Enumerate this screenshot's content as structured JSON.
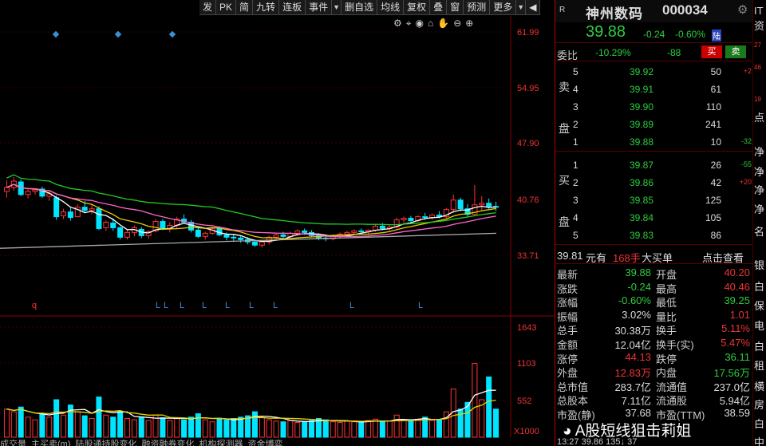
{
  "toolbar": {
    "items": [
      "发",
      "PK",
      "简",
      "九转",
      "连板",
      "事件",
      "删自选",
      "均线",
      "复权",
      "叠",
      "窗",
      "预测",
      "更多"
    ]
  },
  "chart": {
    "y_labels": [
      "61.99",
      "54.95",
      "47.90",
      "40.76",
      "33.71"
    ],
    "vol_labels": [
      "1643",
      "1103",
      "552",
      "X1000"
    ],
    "markers": [
      "q",
      "L",
      "L",
      "L",
      "L",
      "L",
      "L",
      "L",
      "L",
      "L"
    ],
    "colors": {
      "up": "#ff3333",
      "down": "#00e5ff",
      "ma_white": "#ffffff",
      "ma_yellow": "#e8d000",
      "ma_pink": "#ff66cc",
      "ma_green": "#22cc22",
      "ma_gray": "#aaaaaa"
    }
  },
  "chart_data": {
    "type": "candlestick",
    "y_ticks": [
      61.99,
      54.95,
      47.9,
      40.76,
      33.71
    ],
    "volume_ticks": [
      1643,
      1103,
      552
    ],
    "volume_unit": "X1000",
    "candles": [
      [
        41.8,
        43.2,
        41.0,
        42.3
      ],
      [
        42.3,
        43.6,
        41.9,
        43.1
      ],
      [
        43.0,
        43.3,
        41.2,
        41.4
      ],
      [
        41.4,
        42.1,
        40.9,
        41.8
      ],
      [
        41.8,
        42.2,
        41.4,
        42.0
      ],
      [
        42.1,
        42.4,
        41.0,
        41.2
      ],
      [
        41.2,
        41.8,
        40.6,
        41.5
      ],
      [
        41.0,
        41.3,
        38.2,
        38.6
      ],
      [
        38.7,
        39.6,
        38.3,
        39.2
      ],
      [
        39.2,
        39.8,
        38.1,
        38.5
      ],
      [
        38.6,
        40.2,
        38.5,
        39.8
      ],
      [
        39.8,
        40.6,
        39.1,
        39.4
      ],
      [
        39.4,
        40.2,
        38.9,
        39.6
      ],
      [
        39.6,
        39.9,
        36.9,
        37.1
      ],
      [
        37.2,
        38.1,
        36.8,
        37.9
      ],
      [
        37.8,
        38.4,
        36.8,
        37.2
      ],
      [
        37.2,
        37.4,
        35.7,
        36.0
      ],
      [
        36.0,
        36.9,
        35.7,
        36.6
      ],
      [
        36.6,
        37.5,
        36.1,
        37.2
      ],
      [
        37.0,
        37.3,
        35.9,
        36.2
      ],
      [
        36.2,
        36.9,
        35.8,
        36.7
      ],
      [
        36.8,
        38.3,
        36.6,
        38.0
      ],
      [
        38.0,
        38.3,
        36.9,
        37.1
      ],
      [
        37.1,
        37.9,
        36.6,
        37.5
      ],
      [
        37.5,
        38.6,
        37.1,
        38.3
      ],
      [
        38.3,
        38.9,
        37.7,
        37.9
      ],
      [
        37.9,
        38.2,
        36.6,
        36.9
      ],
      [
        36.9,
        37.2,
        35.9,
        36.1
      ],
      [
        36.1,
        36.7,
        35.7,
        36.5
      ],
      [
        36.5,
        37.3,
        36.3,
        37.1
      ],
      [
        37.1,
        37.4,
        36.1,
        36.3
      ],
      [
        36.3,
        36.6,
        35.6,
        36.0
      ],
      [
        36.0,
        36.4,
        35.4,
        35.9
      ],
      [
        35.9,
        36.2,
        35.3,
        35.7
      ],
      [
        35.7,
        36.0,
        35.1,
        35.4
      ],
      [
        35.4,
        35.7,
        34.8,
        35.0
      ],
      [
        35.0,
        35.6,
        34.7,
        35.4
      ],
      [
        35.4,
        36.2,
        35.1,
        36.0
      ],
      [
        36.0,
        36.5,
        35.7,
        36.3
      ],
      [
        36.3,
        36.7,
        35.8,
        36.1
      ],
      [
        36.1,
        36.7,
        35.8,
        36.5
      ],
      [
        36.5,
        37.0,
        36.2,
        36.8
      ],
      [
        36.8,
        37.1,
        36.3,
        36.6
      ],
      [
        36.6,
        36.9,
        36.0,
        36.2
      ],
      [
        36.2,
        36.5,
        35.6,
        35.9
      ],
      [
        35.9,
        36.2,
        35.5,
        35.8
      ],
      [
        35.8,
        36.3,
        35.6,
        36.1
      ],
      [
        36.1,
        36.6,
        35.9,
        36.4
      ],
      [
        36.4,
        36.8,
        36.1,
        36.6
      ],
      [
        36.6,
        37.0,
        36.3,
        36.8
      ],
      [
        36.8,
        37.1,
        36.4,
        36.7
      ],
      [
        36.7,
        37.0,
        36.3,
        36.9
      ],
      [
        36.9,
        37.6,
        36.7,
        37.4
      ],
      [
        37.4,
        37.8,
        36.9,
        37.1
      ],
      [
        37.1,
        37.5,
        36.8,
        37.3
      ],
      [
        37.3,
        38.5,
        37.1,
        38.2
      ],
      [
        38.2,
        38.6,
        37.8,
        38.4
      ],
      [
        38.4,
        38.7,
        37.9,
        38.1
      ],
      [
        38.1,
        38.8,
        37.9,
        38.6
      ],
      [
        38.6,
        39.1,
        38.2,
        38.5
      ],
      [
        38.5,
        39.0,
        38.2,
        38.8
      ],
      [
        38.8,
        39.3,
        38.4,
        38.6
      ],
      [
        38.6,
        39.7,
        38.4,
        39.5
      ],
      [
        39.5,
        41.4,
        39.1,
        40.7
      ],
      [
        40.7,
        41.0,
        39.3,
        39.6
      ],
      [
        39.6,
        40.2,
        38.6,
        38.9
      ],
      [
        38.9,
        42.6,
        38.8,
        40.1
      ],
      [
        40.1,
        41.2,
        39.4,
        40.3
      ],
      [
        40.3,
        40.9,
        39.6,
        39.9
      ],
      [
        39.9,
        40.5,
        39.3,
        39.88
      ]
    ],
    "volumes": [
      420,
      380,
      450,
      300,
      260,
      350,
      300,
      560,
      330,
      480,
      380,
      320,
      280,
      600,
      330,
      300,
      380,
      280,
      260,
      300,
      250,
      330,
      290,
      250,
      280,
      260,
      300,
      350,
      260,
      230,
      270,
      260,
      280,
      300,
      320,
      380,
      290,
      260,
      240,
      230,
      250,
      220,
      230,
      250,
      280,
      260,
      230,
      220,
      240,
      230,
      220,
      250,
      270,
      230,
      240,
      330,
      260,
      240,
      270,
      300,
      250,
      260,
      380,
      720,
      420,
      520,
      1100,
      560,
      900,
      420
    ]
  },
  "quote": {
    "market": "R",
    "name": "神州数码",
    "code": "000034",
    "price": "39.88",
    "change": "-0.24",
    "change_pct": "-0.60%",
    "badge": "陆",
    "weibi_label": "委比",
    "weibi_value": "-10.29%",
    "weicha_value": "-88",
    "buy": "买",
    "sell": "卖",
    "ask_side": "卖盘",
    "bid_side": "买盘",
    "asks": [
      {
        "n": "5",
        "p": "39.92",
        "v": "50",
        "d": "+2"
      },
      {
        "n": "4",
        "p": "39.91",
        "v": "61",
        "d": ""
      },
      {
        "n": "3",
        "p": "39.90",
        "v": "110",
        "d": ""
      },
      {
        "n": "2",
        "p": "39.89",
        "v": "241",
        "d": ""
      },
      {
        "n": "1",
        "p": "39.88",
        "v": "10",
        "d": "-32"
      }
    ],
    "bids": [
      {
        "n": "1",
        "p": "39.87",
        "v": "26",
        "d": "-55"
      },
      {
        "n": "2",
        "p": "39.86",
        "v": "42",
        "d": "+20"
      },
      {
        "n": "3",
        "p": "39.85",
        "v": "125",
        "d": ""
      },
      {
        "n": "4",
        "p": "39.84",
        "v": "105",
        "d": ""
      },
      {
        "n": "5",
        "p": "39.83",
        "v": "86",
        "d": ""
      }
    ],
    "tick_price": "39.81",
    "tick_unit": "元有",
    "tick_hands": "168手",
    "tick_label": "大买单",
    "tick_link": "点击查看",
    "stats": [
      {
        "l1": "最新",
        "v1": "39.88",
        "c1": "g",
        "l2": "开盘",
        "v2": "40.20",
        "c2": "r"
      },
      {
        "l1": "涨跌",
        "v1": "-0.24",
        "c1": "g",
        "l2": "最高",
        "v2": "40.46",
        "c2": "r"
      },
      {
        "l1": "涨幅",
        "v1": "-0.60%",
        "c1": "g",
        "l2": "最低",
        "v2": "39.25",
        "c2": "g"
      },
      {
        "l1": "振幅",
        "v1": "3.02%",
        "c1": "w",
        "l2": "量比",
        "v2": "1.01",
        "c2": "r"
      },
      {
        "l1": "总手",
        "v1": "30.38万",
        "c1": "w",
        "l2": "换手",
        "v2": "5.11%",
        "c2": "r"
      },
      {
        "l1": "金额",
        "v1": "12.04亿",
        "c1": "w",
        "l2": "换手(实)",
        "v2": "5.47%",
        "c2": "r"
      },
      {
        "l1": "涨停",
        "v1": "44.13",
        "c1": "r",
        "l2": "跌停",
        "v2": "36.11",
        "c2": "g"
      },
      {
        "l1": "外盘",
        "v1": "12.83万",
        "c1": "r",
        "l2": "内盘",
        "v2": "17.56万",
        "c2": "g"
      },
      {
        "l1": "总市值",
        "v1": "283.7亿",
        "c1": "w",
        "l2": "流通值",
        "v2": "237.0亿",
        "c2": "w"
      },
      {
        "l1": "总股本",
        "v1": "7.11亿",
        "c1": "w",
        "l2": "流通股",
        "v2": "5.94亿",
        "c2": "w"
      },
      {
        "l1": "市盈(静)",
        "v1": "37.68",
        "c1": "w",
        "l2": "市盈(TTM)",
        "v2": "38.59",
        "c2": "w"
      }
    ],
    "footer": "13:27    39.86    135↓    37"
  },
  "right_strip": [
    "IT",
    "资",
    "27",
    "46",
    "19",
    "点",
    "净",
    "净",
    "净",
    "净",
    "名",
    "银",
    "白",
    "保",
    "电",
    "白",
    "租",
    "横",
    "房",
    "白",
    "中"
  ],
  "bottom_tabs": [
    "成交量",
    "主买卖(m)",
    "陆股通持股变化",
    "融资融券变化",
    "机构探测器",
    "资金博弈"
  ],
  "watermark": "A股短线狙击莉姐"
}
